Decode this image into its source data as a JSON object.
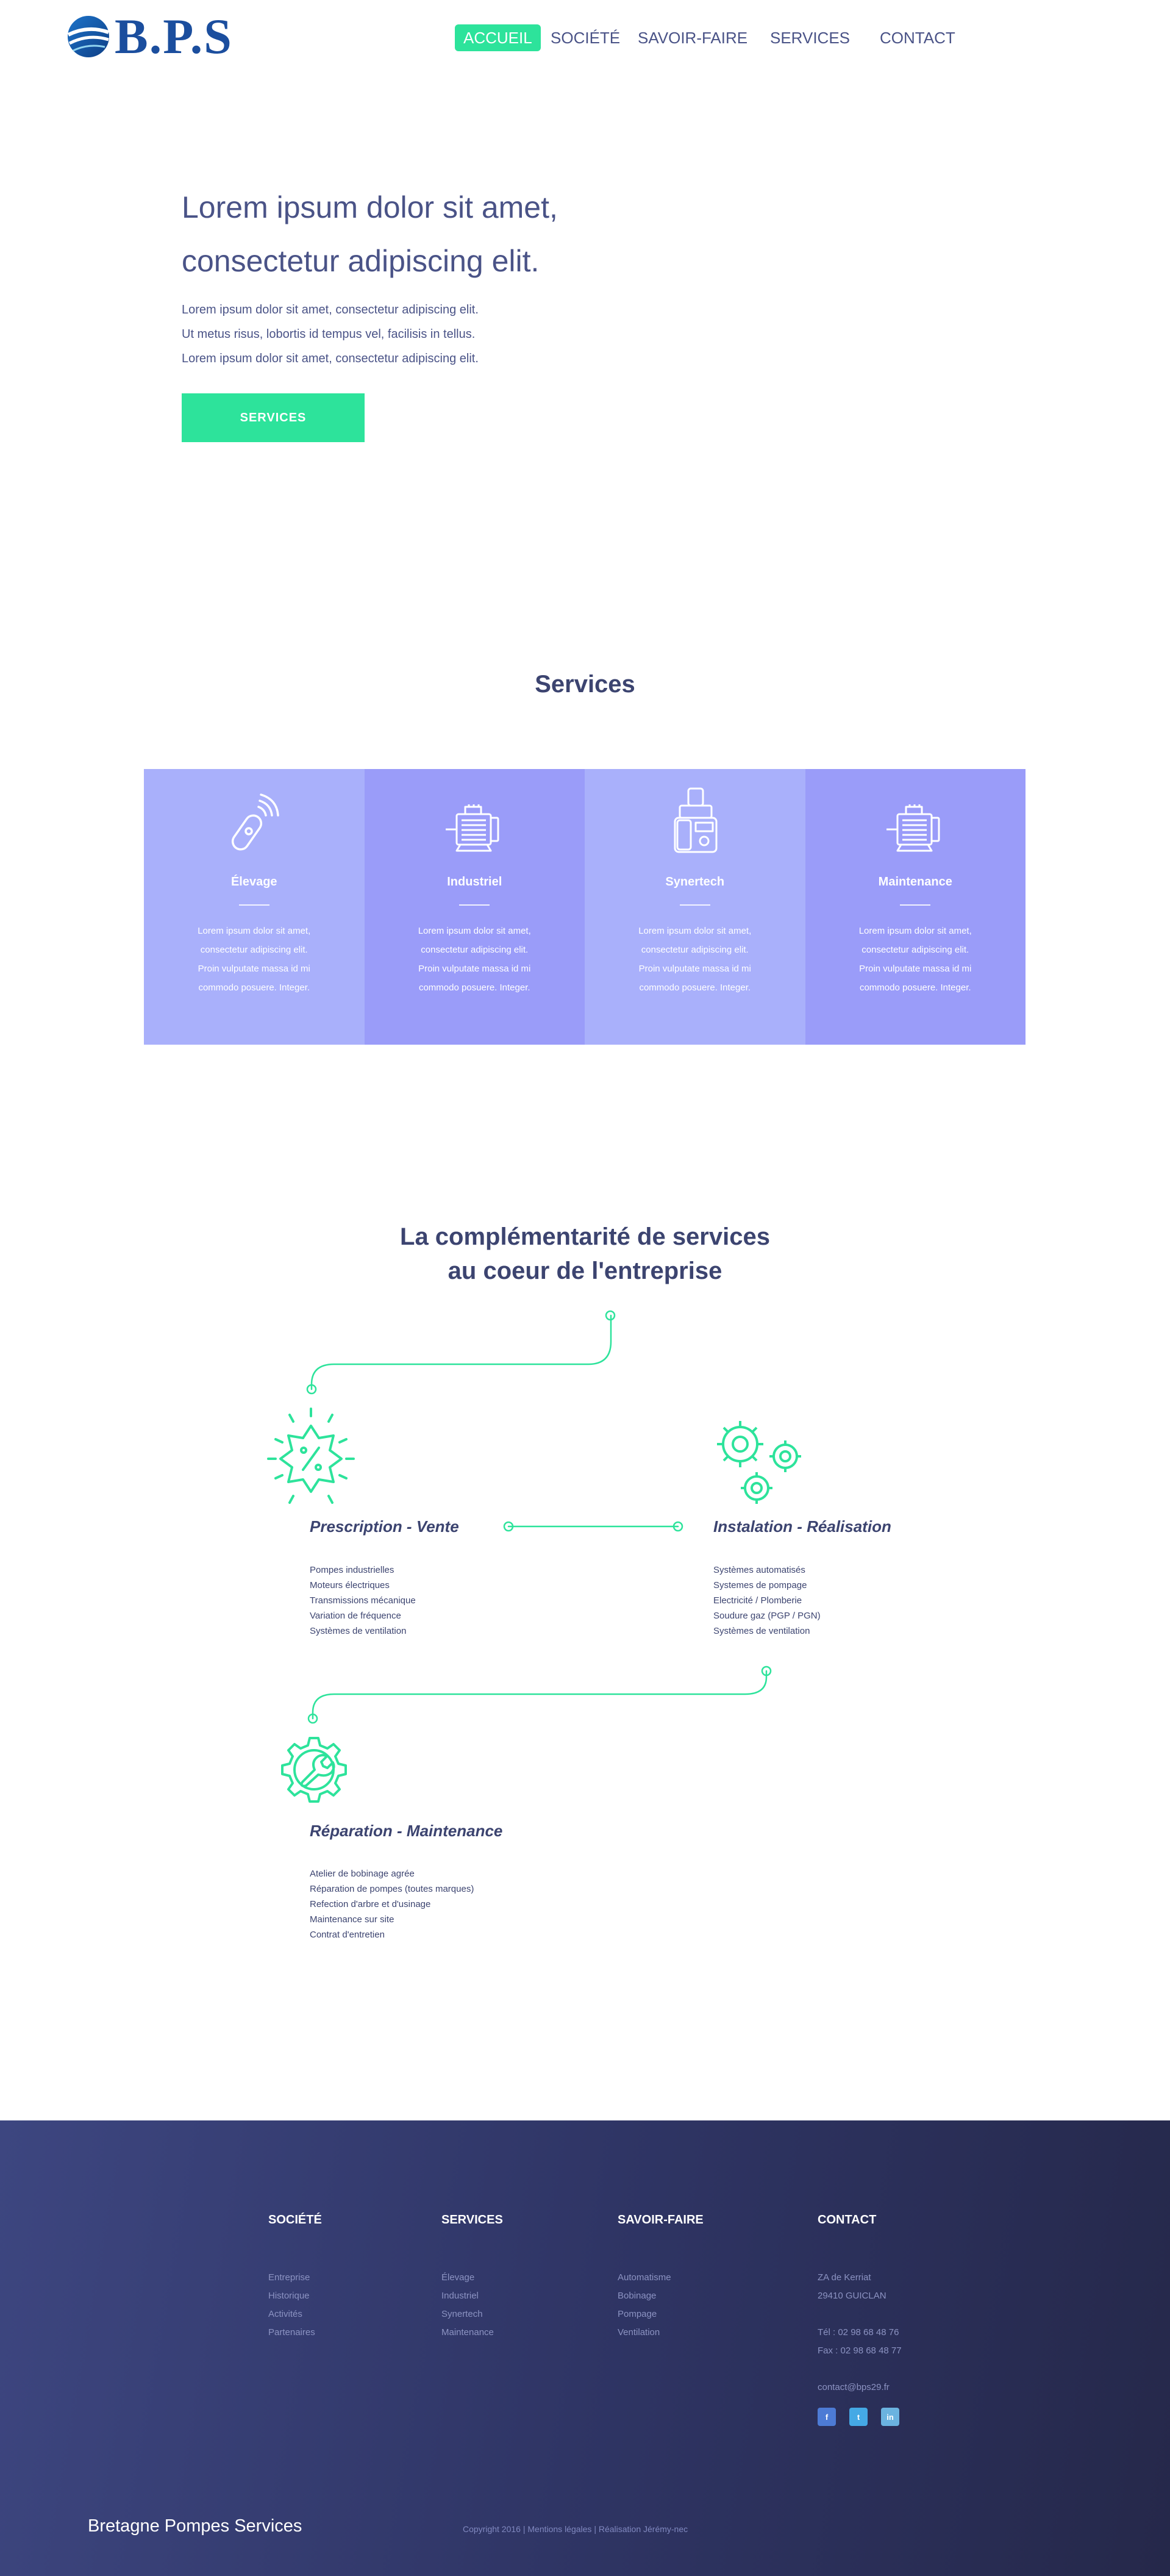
{
  "brand": {
    "logo_text": "B.P.S"
  },
  "nav": {
    "items": [
      "ACCUEIL",
      "SOCIÉTÉ",
      "SAVOIR-FAIRE",
      "SERVICES",
      "CONTACT"
    ]
  },
  "hero": {
    "title_line1": "Lorem ipsum dolor sit amet,",
    "title_line2": "consectetur adipiscing elit.",
    "lines": [
      "Lorem ipsum dolor sit amet, consectetur adipiscing elit.",
      "Ut metus risus, lobortis id tempus vel, facilisis in tellus.",
      "Lorem ipsum dolor sit amet, consectetur adipiscing elit."
    ],
    "button": "SERVICES"
  },
  "services": {
    "heading": "Services",
    "cards": [
      {
        "title": "Élevage",
        "icon": "remote-control-icon",
        "lines": [
          "Lorem ipsum dolor sit amet,",
          "consectetur adipiscing elit.",
          "Proin vulputate massa id mi",
          "commodo posuere. Integer."
        ]
      },
      {
        "title": "Industriel",
        "icon": "electric-motor-icon",
        "lines": [
          "Lorem ipsum dolor sit amet,",
          "consectetur adipiscing elit.",
          "Proin vulputate massa id mi",
          "commodo posuere. Integer."
        ]
      },
      {
        "title": "Synertech",
        "icon": "pump-machine-icon",
        "lines": [
          "Lorem ipsum dolor sit amet,",
          "consectetur adipiscing elit.",
          "Proin vulputate massa id mi",
          "commodo posuere. Integer."
        ]
      },
      {
        "title": "Maintenance",
        "icon": "electric-motor-icon",
        "lines": [
          "Lorem ipsum dolor sit amet,",
          "consectetur adipiscing elit.",
          "Proin vulputate massa id mi",
          "commodo posuere. Integer."
        ]
      }
    ]
  },
  "complementarite": {
    "title_line1": "La complémentarité de services",
    "title_line2": "au coeur de l'entreprise",
    "steps": [
      {
        "title": "Prescription - Vente",
        "icon": "percent-badge-icon",
        "items": [
          "Pompes industrielles",
          "Moteurs électriques",
          "Transmissions mécanique",
          "Variation de fréquence",
          "Systèmes de ventilation"
        ]
      },
      {
        "title": "Instalation - Réalisation",
        "icon": "gears-icon",
        "items": [
          "Systèmes automatisés",
          "Systemes de pompage",
          "Electricité / Plomberie",
          "Soudure gaz (PGP / PGN)",
          "Systèmes de ventilation"
        ]
      },
      {
        "title": "Réparation - Maintenance",
        "icon": "wrench-gear-icon",
        "items": [
          "Atelier de bobinage agrée",
          "Réparation de pompes (toutes marques)",
          "Refection d'arbre et d'usinage",
          "Maintenance sur site",
          "Contrat d'entretien"
        ]
      }
    ],
    "accent_color": "#2de39b"
  },
  "footer": {
    "columns": [
      {
        "heading": "SOCIÉTÉ",
        "items": [
          "Entreprise",
          "Historique",
          "Activités",
          "Partenaires"
        ]
      },
      {
        "heading": "SERVICES",
        "items": [
          "Élevage",
          "Industriel",
          "Synertech",
          "Maintenance"
        ]
      },
      {
        "heading": "SAVOIR-FAIRE",
        "items": [
          "Automatisme",
          "Bobinage",
          "Pompage",
          "Ventilation"
        ]
      }
    ],
    "contact": {
      "heading": "CONTACT",
      "address1": "ZA de Kerriat",
      "address2": "29410 GUICLAN",
      "tel": "Tél : 02 98 68 48 76",
      "fax": "Fax : 02 98 68 48 77",
      "email": "contact@bps29.fr",
      "socials": [
        "f",
        "t",
        "in"
      ]
    },
    "company": "Bretagne Pompes Services",
    "copyright": "Copyright 2016 | Mentions légales | Réalisation Jérémy-nec"
  },
  "colors": {
    "accent": "#2de39b",
    "text": "#3c4470",
    "brand": "#1b4e9e",
    "card_light": "#a9b0fb",
    "card_dark": "#9a9cf9"
  }
}
